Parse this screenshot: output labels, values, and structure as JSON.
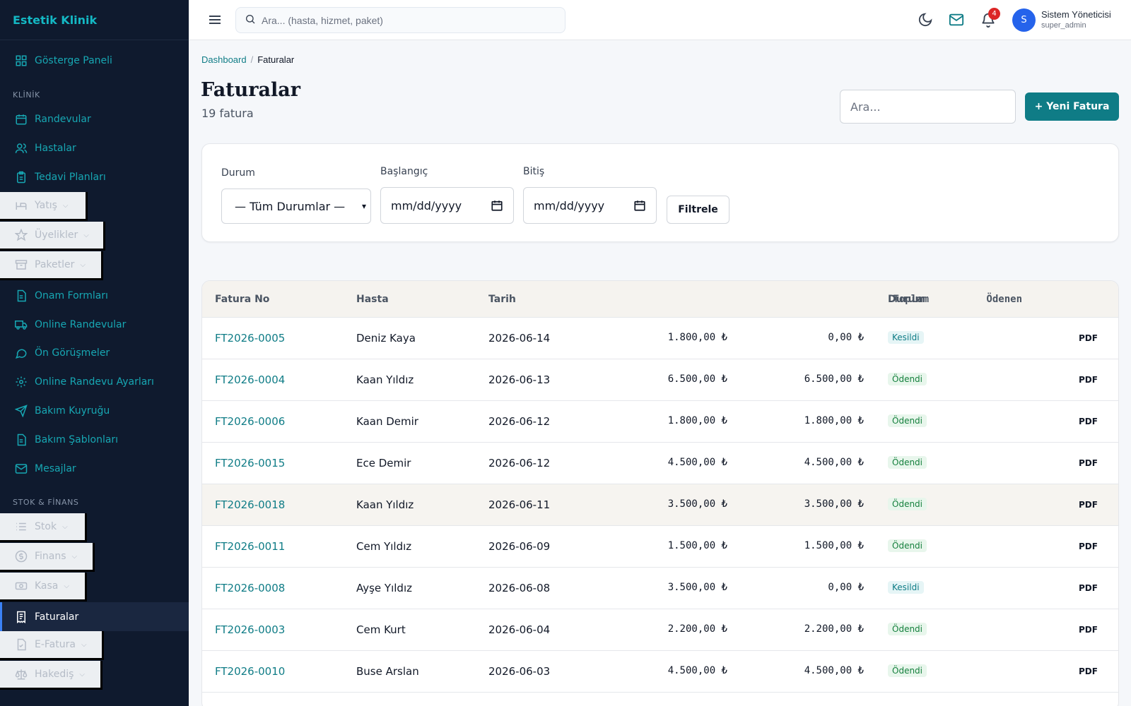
{
  "app": {
    "brand": "Estetik Klinik"
  },
  "sidebar": {
    "dashboard": "Gösterge Paneli",
    "section_clinic": "KLİNİK",
    "section_stock": "STOK & FİNANS",
    "items": [
      {
        "label": "Randevular",
        "icon": "calendar-icon"
      },
      {
        "label": "Hastalar",
        "icon": "users-icon"
      },
      {
        "label": "Tedavi Planları",
        "icon": "clipboard-icon"
      },
      {
        "label": "Yatış",
        "icon": "bed-icon"
      },
      {
        "label": "Üyelikler",
        "icon": "star-icon"
      },
      {
        "label": "Paketler",
        "icon": "archive-icon"
      },
      {
        "label": "Onam Formları",
        "icon": "document-icon"
      },
      {
        "label": "Online Randevular",
        "icon": "truck-icon"
      },
      {
        "label": "Ön Görüşmeler",
        "icon": "chat-icon"
      },
      {
        "label": "Online Randevu Ayarları",
        "icon": "gear-icon"
      },
      {
        "label": "Bakım Kuyruğu",
        "icon": "send-icon"
      },
      {
        "label": "Bakım Şablonları",
        "icon": "document-icon"
      },
      {
        "label": "Mesajlar",
        "icon": "mail-icon"
      },
      {
        "label": "Stok",
        "icon": "list-icon"
      },
      {
        "label": "Finans",
        "icon": "dollar-icon"
      },
      {
        "label": "Kasa",
        "icon": "cash-icon"
      },
      {
        "label": "Faturalar",
        "icon": "receipt-icon"
      },
      {
        "label": "E-Fatura",
        "icon": "document-icon"
      },
      {
        "label": "Hakediş",
        "icon": "scale-icon"
      }
    ]
  },
  "topbar": {
    "search_placeholder": "Ara... (hasta, hizmet, paket)",
    "notification_count": "4",
    "user_initial": "S",
    "user_name": "Sistem Yöneticisi",
    "user_role": "super_admin"
  },
  "breadcrumb": {
    "root": "Dashboard",
    "sep": "/",
    "current": "Faturalar"
  },
  "page": {
    "title": "Faturalar",
    "subtitle": "19 fatura",
    "search_placeholder": "Ara...",
    "new_button": "+ Yeni Fatura"
  },
  "filters": {
    "status_label": "Durum",
    "status_value": "— Tüm Durumlar —",
    "start_label": "Başlangıç",
    "start_value": "mm/dd/yyyy",
    "end_label": "Bitiş",
    "end_value": "mm/dd/yyyy",
    "filter_button": "Filtrele"
  },
  "table": {
    "headers": [
      "Fatura No",
      "Hasta",
      "Tarih",
      "Toplam",
      "Ödenen",
      "Durum"
    ],
    "rows": [
      {
        "no": "FT2026-0005",
        "patient": "Deniz Kaya",
        "date": "2026-06-14",
        "total": "1.800,00 ₺",
        "paid": "0,00 ₺",
        "status": "Kesildi",
        "action": "PDF"
      },
      {
        "no": "FT2026-0004",
        "patient": "Kaan Yıldız",
        "date": "2026-06-13",
        "total": "6.500,00 ₺",
        "paid": "6.500,00 ₺",
        "status": "Ödendi",
        "action": "PDF"
      },
      {
        "no": "FT2026-0006",
        "patient": "Kaan Demir",
        "date": "2026-06-12",
        "total": "1.800,00 ₺",
        "paid": "1.800,00 ₺",
        "status": "Ödendi",
        "action": "PDF"
      },
      {
        "no": "FT2026-0015",
        "patient": "Ece Demir",
        "date": "2026-06-12",
        "total": "4.500,00 ₺",
        "paid": "4.500,00 ₺",
        "status": "Ödendi",
        "action": "PDF"
      },
      {
        "no": "FT2026-0018",
        "patient": "Kaan Yıldız",
        "date": "2026-06-11",
        "total": "3.500,00 ₺",
        "paid": "3.500,00 ₺",
        "status": "Ödendi",
        "action": "PDF"
      },
      {
        "no": "FT2026-0011",
        "patient": "Cem Yıldız",
        "date": "2026-06-09",
        "total": "1.500,00 ₺",
        "paid": "1.500,00 ₺",
        "status": "Ödendi",
        "action": "PDF"
      },
      {
        "no": "FT2026-0008",
        "patient": "Ayşe Yıldız",
        "date": "2026-06-08",
        "total": "3.500,00 ₺",
        "paid": "0,00 ₺",
        "status": "Kesildi",
        "action": "PDF"
      },
      {
        "no": "FT2026-0003",
        "patient": "Cem Kurt",
        "date": "2026-06-04",
        "total": "2.200,00 ₺",
        "paid": "2.200,00 ₺",
        "status": "Ödendi",
        "action": "PDF"
      },
      {
        "no": "FT2026-0010",
        "patient": "Buse Arslan",
        "date": "2026-06-03",
        "total": "4.500,00 ₺",
        "paid": "4.500,00 ₺",
        "status": "Ödendi",
        "action": "PDF"
      }
    ]
  },
  "colors": {
    "accent": "#0f7c86",
    "sidebar_bg": "#0f1a2e",
    "sidebar_text": "#17a7b3",
    "badge": "#dc2626",
    "avatar": "#2563eb"
  }
}
